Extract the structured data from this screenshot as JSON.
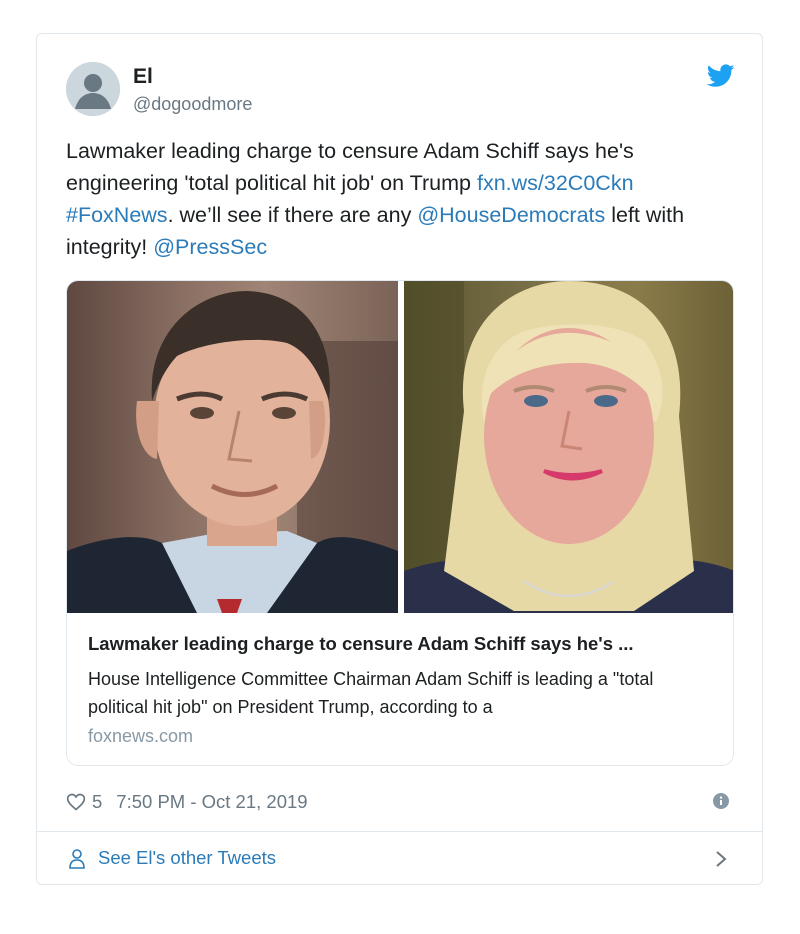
{
  "author": {
    "display_name": "El",
    "handle": "@dogoodmore"
  },
  "tweet": {
    "text_1": "Lawmaker leading charge to censure Adam Schiff says he's engineering 'total political hit job' on Trump ",
    "link_url": "fxn.ws/32C0Ckn",
    "hashtag": "#FoxNews",
    "text_2": ". we’ll see if there are any ",
    "mention_1": "@HouseDemocrats",
    "text_3": "  left with integrity! ",
    "mention_2": "@PressSec"
  },
  "link_card": {
    "title": "Lawmaker leading charge to censure Adam Schiff says he's ...",
    "description": "House Intelligence Committee Chairman Adam Schiff is leading a \"total political hit job\" on President Trump, according to a",
    "domain": "foxnews.com"
  },
  "meta": {
    "likes": "5",
    "timestamp": "7:50 PM - Oct 21, 2019"
  },
  "footer": {
    "label": "See El's other Tweets"
  },
  "icons": [
    "twitter-bird-icon",
    "heart-icon",
    "info-icon",
    "person-icon",
    "chevron-right-icon"
  ],
  "colors": {
    "link": "#2b7bb9",
    "twitter_blue": "#1da1f2",
    "muted": "#697882",
    "border": "#e1e8ed"
  }
}
